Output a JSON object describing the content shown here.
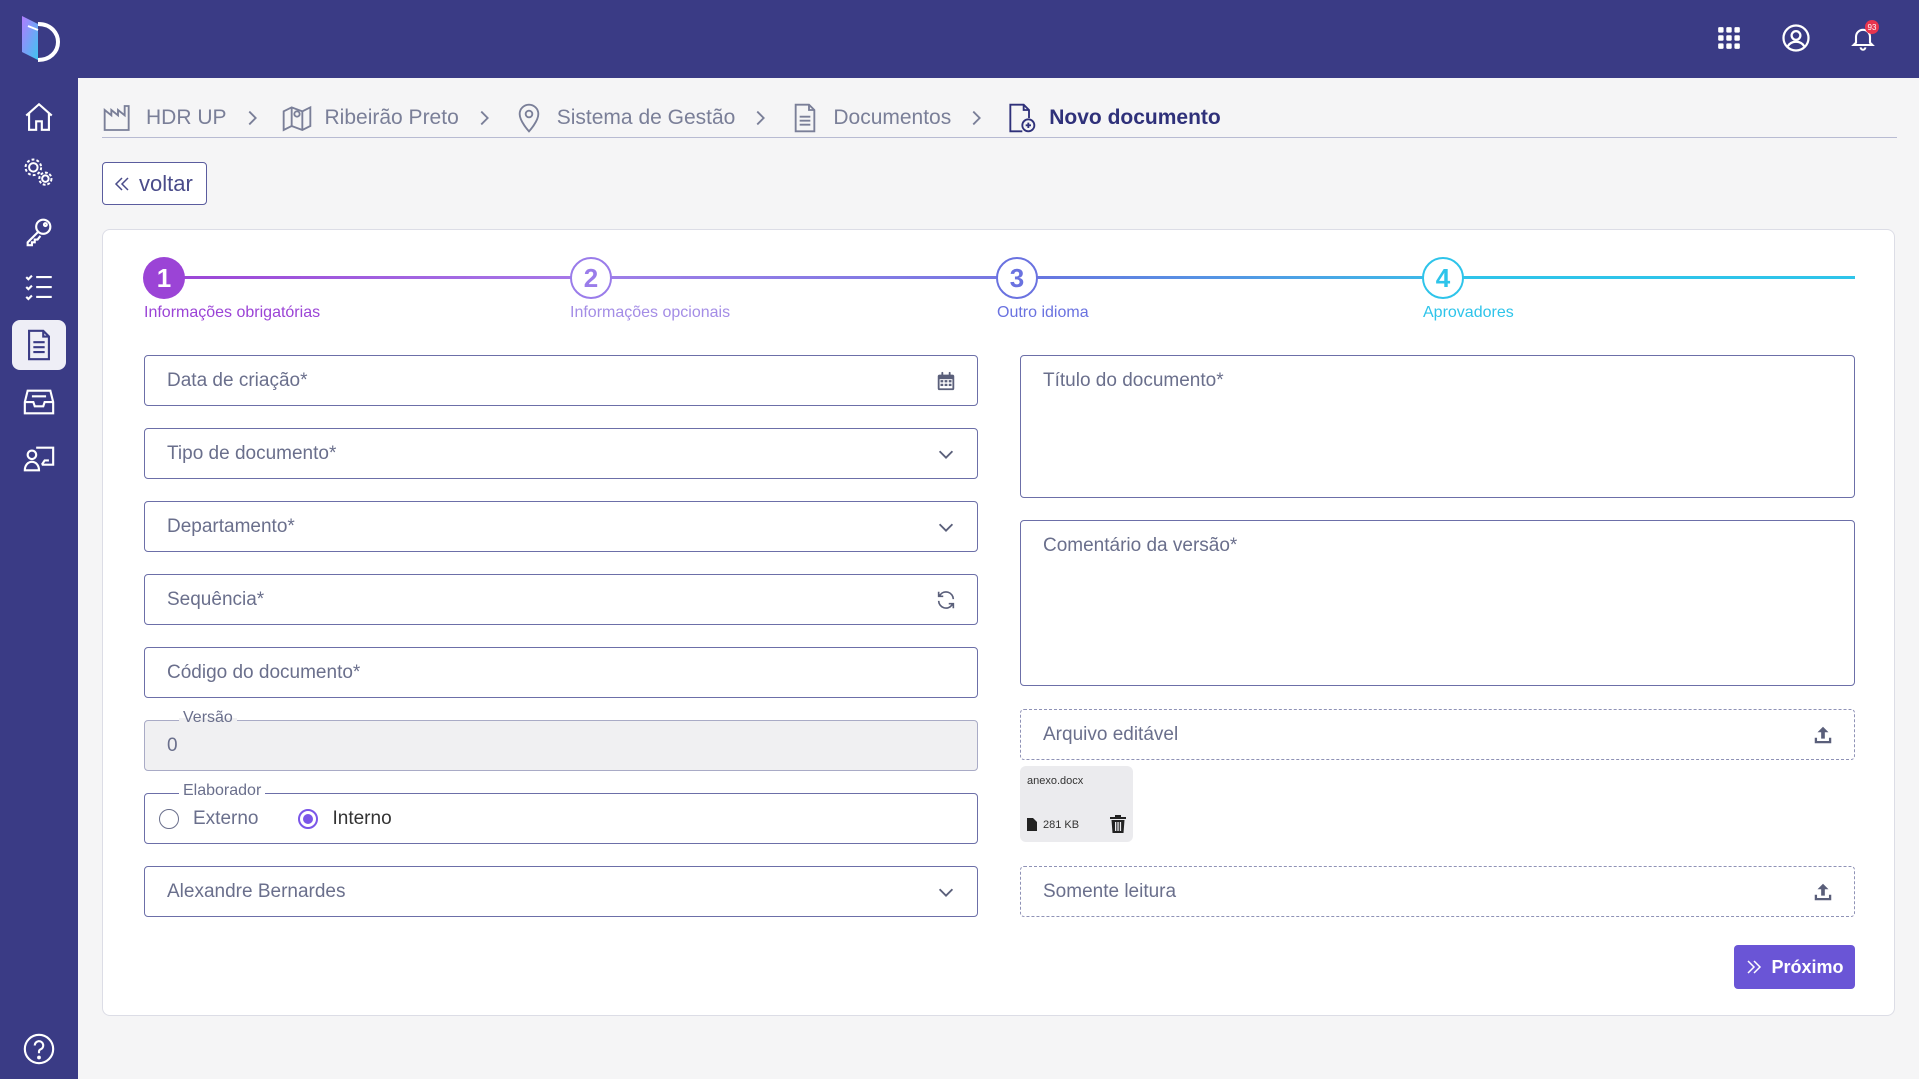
{
  "topbar": {
    "apps_icon": "grid-icon",
    "account_icon": "user-circle-icon",
    "notifications_icon": "bell-icon",
    "notifications_count": "93"
  },
  "sidebar": {
    "items": [
      {
        "name": "home",
        "icon": "home-icon"
      },
      {
        "name": "settings",
        "icon": "gears-icon"
      },
      {
        "name": "keys",
        "icon": "key-icon"
      },
      {
        "name": "checklist",
        "icon": "checklist-icon"
      },
      {
        "name": "documents",
        "icon": "document-icon",
        "active": true
      },
      {
        "name": "inbox",
        "icon": "inbox-icon"
      },
      {
        "name": "training",
        "icon": "presenter-icon"
      }
    ],
    "help_icon": "help-icon"
  },
  "breadcrumb": [
    {
      "label": "HDR UP",
      "icon": "factory-icon"
    },
    {
      "label": "Ribeirão Preto",
      "icon": "map-icon"
    },
    {
      "label": "Sistema de Gestão",
      "icon": "location-pin-icon"
    },
    {
      "label": "Documentos",
      "icon": "file-icon"
    },
    {
      "label": "Novo documento",
      "icon": "file-add-icon",
      "current": true
    }
  ],
  "back_button": {
    "label": "voltar"
  },
  "stepper": {
    "steps": [
      {
        "number": "1",
        "label": "Informações obrigatórias",
        "color": "#9b44d6",
        "active": true
      },
      {
        "number": "2",
        "label": "Informações opcionais",
        "color": "#9a7cea"
      },
      {
        "number": "3",
        "label": "Outro idioma",
        "color": "#6a72e0"
      },
      {
        "number": "4",
        "label": "Aprovadores",
        "color": "#2ec4ea"
      }
    ]
  },
  "form": {
    "creation_date": {
      "placeholder": "Data de criação*"
    },
    "document_type": {
      "placeholder": "Tipo de documento*"
    },
    "department": {
      "placeholder": "Departamento*"
    },
    "sequence": {
      "placeholder": "Sequência*"
    },
    "document_code": {
      "placeholder": "Código do documento*"
    },
    "version": {
      "label": "Versão",
      "value": "0"
    },
    "author": {
      "label": "Elaborador",
      "options": [
        "Externo",
        "Interno"
      ],
      "selected": "Interno"
    },
    "responsible": {
      "value": "Alexandre Bernardes"
    },
    "document_title": {
      "placeholder": "Título do documento*"
    },
    "version_comment": {
      "placeholder": "Comentário da versão*"
    },
    "editable_file": {
      "placeholder": "Arquivo editável"
    },
    "attached_file": {
      "name": "anexo.docx",
      "size": "281 KB"
    },
    "read_only_file": {
      "placeholder": "Somente leitura"
    }
  },
  "next_button": {
    "label": "Próximo"
  }
}
